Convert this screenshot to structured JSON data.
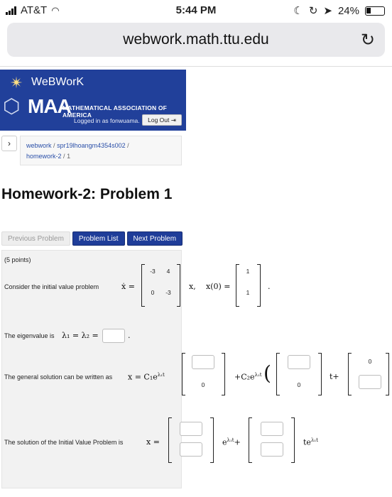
{
  "status_bar": {
    "carrier": "AT&T",
    "time": "5:44 PM",
    "battery": "24%"
  },
  "browser": {
    "url": "webwork.math.ttu.edu"
  },
  "banner": {
    "webwork_label": "WeBWorK",
    "maa_label": "MAA",
    "maa_full": "MATHEMATICAL ASSOCIATION OF AMERICA",
    "logged_in": "Logged in as fonwuama.",
    "logout_label": "Log Out"
  },
  "breadcrumb": {
    "items": [
      "webwork",
      "spr19lhoangm4354s002",
      "homework-2",
      "1"
    ],
    "separator": "/"
  },
  "page_title": "Homework-2: Problem 1",
  "problem_nav": {
    "previous": "Previous Problem",
    "list": "Problem List",
    "next": "Next Problem"
  },
  "problem": {
    "points": "(5 points)",
    "intro": "Consider the initial value problem",
    "xdot": "ẋ =",
    "matrix_A": [
      "-3",
      "4",
      "0",
      "-3"
    ],
    "x_var": "x,",
    "x0_label": "x(0) =",
    "x0": [
      "1",
      "1"
    ],
    "period": ".",
    "eigen_text": "The eigenvalue is",
    "eigen_math": "λ₁ = λ₂ =",
    "general_text": "The general solution can be written as",
    "general_math1": "x = C₁e",
    "general_exp": "λ₁t",
    "general_math2": "+C₂e",
    "zero": "0",
    "tplus": "t+",
    "ivp_text": "The solution of the Initial Value Problem is",
    "ivp_math": "x =",
    "ivp_exp1": "e",
    "ivp_exp1_sup": "λ₁t",
    "plus": "+",
    "ivp_exp2": "te",
    "ivp_exp2_sup": "λ₁t"
  }
}
